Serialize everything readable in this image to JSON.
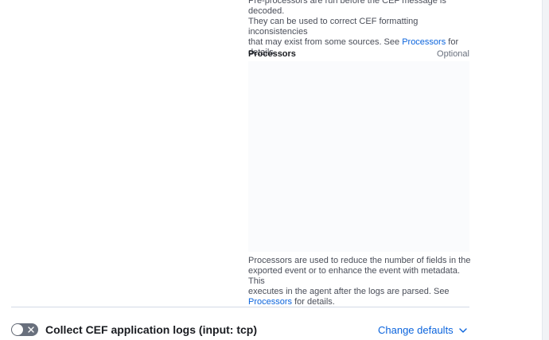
{
  "preprocessor_help": {
    "line1": "Pre-processors are run before the CEF message is decoded.",
    "line2": "They can be used to correct CEF formatting inconsistencies",
    "line3_before_link": "that may exist from some sources. See ",
    "line3_link": "Processors",
    "line3_after_link": " for",
    "line4": "details."
  },
  "processors_field": {
    "label": "Processors",
    "optional": "Optional",
    "value": ""
  },
  "processors_help": {
    "line1": "Processors are used to reduce the number of fields in the",
    "line2": "exported event or to enhance the event with metadata. This",
    "line3": "executes in the agent after the logs are parsed. See",
    "line4_link": "Processors",
    "line4_after_link": " for details."
  },
  "tcp_section": {
    "title": "Collect CEF application logs (input: tcp)",
    "toggle_on": false,
    "change_defaults_label": "Change defaults"
  },
  "colors": {
    "link": "#0b64dd",
    "toggle_off": "#69707d",
    "editor_bg": "#fafbfd",
    "divider": "#d3dae6"
  },
  "icons": {
    "toggle": "x-icon",
    "expand": "chevron-down-icon"
  }
}
